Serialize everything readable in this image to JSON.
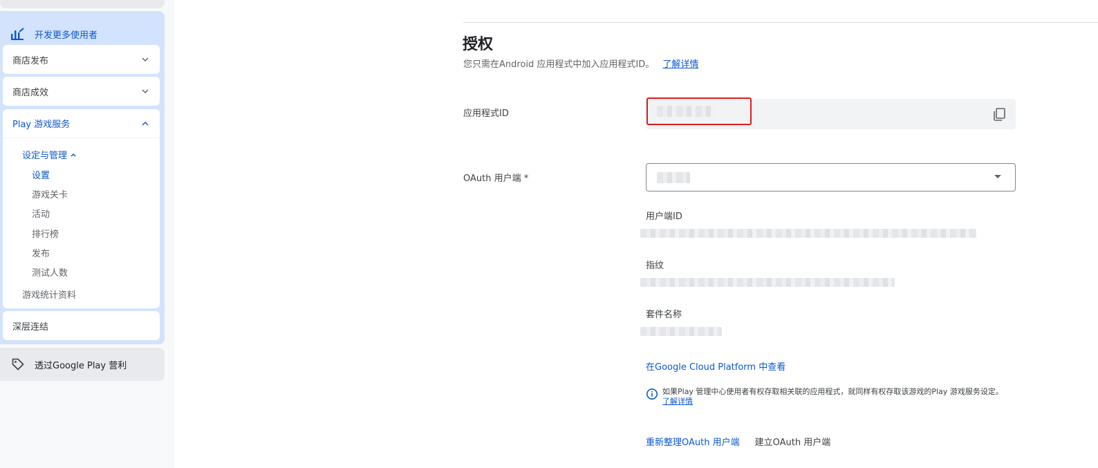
{
  "sidebar": {
    "group_label": "开发更多使用者",
    "store_publish": "商店发布",
    "store_performance": "商店成效",
    "play_games": {
      "label": "Play 游戏服务",
      "setup_label": "设定与管理",
      "items": [
        "设置",
        "游戏关卡",
        "活动",
        "排行榜",
        "发布",
        "测试人数"
      ],
      "stats_label": "游戏统计资料"
    },
    "deep_links": "深层连结",
    "monetize": "透过Google Play 营利"
  },
  "main": {
    "title": "授权",
    "subtitle": "您只需在Android 应用程式中加入应用程式ID。",
    "learn_more": "了解详情",
    "app_id_label": "应用程式ID",
    "oauth_label": "OAuth 用户端 *",
    "client_id_label": "用户端ID",
    "fingerprint_label": "指纹",
    "package_label": "套件名称",
    "gcp_link": "在Google Cloud Platform 中查看",
    "notice": "如果Play 管理中心使用者有权存取相关联的应用程式，就同样有权存取该游戏的Play 游戏服务设定。",
    "notice_link": "了解详情",
    "refresh_button": "重新整理OAuth 用户端",
    "create_button": "建立OAuth 用户端"
  },
  "colors": {
    "accent": "#0b57d0",
    "nav_group_bg": "#d3e3fd",
    "highlight_border": "#e01b1b"
  },
  "icons": {
    "group": "chart-people-icon",
    "promo": "tag-icon",
    "copy": "copy-icon",
    "info": "info-icon"
  }
}
